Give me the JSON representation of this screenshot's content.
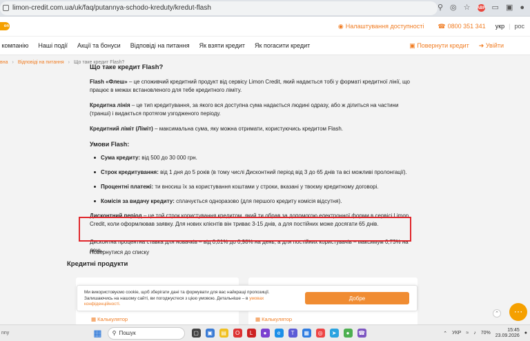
{
  "browser": {
    "url": "limon-credit.com.ua/uk/faq/putannya-schodo-kredutу/kredut-flash",
    "ext_badge": "ABP"
  },
  "topbar": {
    "logo_text": "on",
    "accessibility": "Налаштування доступності",
    "phone": "0800 351 341",
    "lang_active": "укр",
    "lang_other": "рос"
  },
  "nav": {
    "items": [
      "о компанію",
      "Наші події",
      "Акції та бонуси",
      "Відповіді на питання",
      "Як взяти кредит",
      "Як погасити кредит"
    ],
    "repeat_credit": "Повернути кредит",
    "login": "Увійти"
  },
  "breadcrumb": {
    "home": "вна",
    "faq": "Відповіді на питання",
    "current": "Що таке кредит Flash?"
  },
  "article": {
    "title": "Що таке кредит Flash?",
    "p1_term": "Flash «Флеш»",
    "p1_text": " – це споживчий кредитний продукт від сервісу Limon Credit, який надається тобі у форматі кредитної лінії, що працює в межах встановленого для тебе кредитного ліміту.",
    "p2_term": "Кредитна лінія",
    "p2_text": " – це тип кредитування, за якого вся доступна сума надається людині одразу, або ж ділиться на частини (транші) і видається протягом узгодженого періоду.",
    "p3_term": "Кредитний ліміт (Ліміт)",
    "p3_text": " – максимальна сума, яку можна отримати, користуючись кредитом Flash.",
    "conditions_title": "Умови Flash:",
    "conditions": [
      {
        "term": "Сума кредиту:",
        "text": " від 500 до 30 000 грн."
      },
      {
        "term": "Строк кредитування:",
        "text": " від 1 дня до 5 років (в тому числі Дисконтний період від 3 до 65 днів та всі можливі пролонгації)."
      },
      {
        "term": "Процентні платежі:",
        "text": " ти вносиш їх за користування коштами у строки, вказані у твоєму кредитному договорі."
      },
      {
        "term": "Комісія за видачу кредиту:",
        "text": " сплачується одноразово (для першого кредиту комісія відсутня)."
      }
    ],
    "p4_term": "Дисконтний період",
    "p4_text": " – це той строк користування кредитом, який ти обрав за допомогою електронної форми в сервісі Limon Credit, коли оформлював заявку. Для нових клієнтів він триває 3-15 днів, а для постійних може досягати 65 днів.",
    "p5_text": "Дисконтна процентна ставка для новачків – від 0,01% до 0,98% на день, а для постійних користувачів – максимум 0,73% на день.",
    "back_link": "Повернутися до списку",
    "products_title": "Кредитні продукти"
  },
  "cards": {
    "c1_label": "Калькулятор",
    "c2_label": "Калькулятор"
  },
  "cookie": {
    "text": "Ми використовуємо cookie, щоб зберігати дані та формувати для вас найкращі пропозиції. Залишаючись на нашому сайті, ви погоджуєтеся з цією умовою. Детальніше – в ",
    "link": "умовах конфіденційності.",
    "button": "Добре"
  },
  "taskbar": {
    "left_text": "nny",
    "search_placeholder": "Пошук",
    "lang": "УКР",
    "battery": "70%",
    "time": "15:45",
    "date": "23.09.2026"
  }
}
